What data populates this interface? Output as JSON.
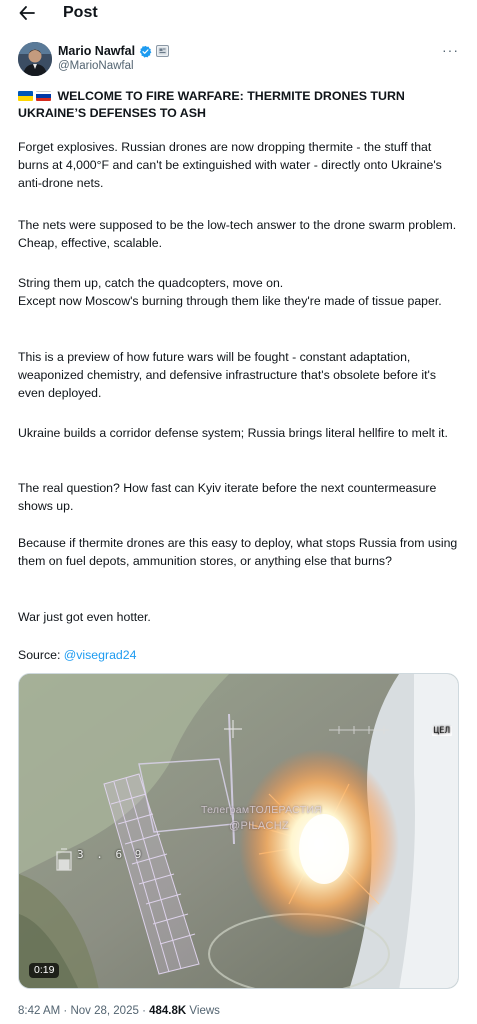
{
  "header": {
    "title": "Post",
    "back_icon": "arrow-left-icon"
  },
  "author": {
    "display_name": "Mario Nawfal",
    "handle": "@MarioNawfal",
    "verified_color": "#1d9bf0",
    "affiliate_icon": "affiliate-badge-icon",
    "more_icon": "more-horizontal-icon"
  },
  "post": {
    "headline": "WELCOME TO FIRE WARFARE: THERMITE DRONES TURN UKRAINE’S DEFENSES TO ASH",
    "flags": [
      "ukraine-flag",
      "russia-flag"
    ],
    "p1": "Forget explosives. Russian drones are now dropping thermite - the stuff that burns at 4,000°F and can't be extinguished with water - directly onto Ukraine's anti-drone nets.",
    "p2": "The nets were supposed to be the low-tech answer to the drone swarm problem. Cheap, effective, scalable.",
    "p3a": "String them up, catch the quadcopters, move on.",
    "p3b": "Except now Moscow's burning through them like they're made of tissue paper.",
    "p4": "This is a preview of how future wars will be fought - constant adaptation, weaponized chemistry, and defensive infrastructure that's obsolete before it's even deployed.",
    "p5": "Ukraine builds a corridor defense system; Russia brings literal hellfire to melt it.",
    "p6": "The real question? How fast can Kyiv iterate before the next countermeasure shows up.",
    "p7": "Because if thermite drones are this easy to deploy, what stops Russia from using them on fuel depots, ammunition stores, or anything else that burns?",
    "p8": "War just got even hotter.",
    "source_label": "Source: ",
    "source_link": "@visegrad24"
  },
  "media": {
    "duration": "0:19",
    "watermark_line1": "ТелеграмТОЛЕРАСТИЯ",
    "watermark_line2": "@PILACHZ",
    "hud_top_right": "ЦЕЛ",
    "hud_left": "3 . 6 9"
  },
  "meta": {
    "time": "8:42 AM",
    "separator": "·",
    "date": "Nov 28, 2025",
    "views_count": "484.8K",
    "views_label": "Views"
  }
}
